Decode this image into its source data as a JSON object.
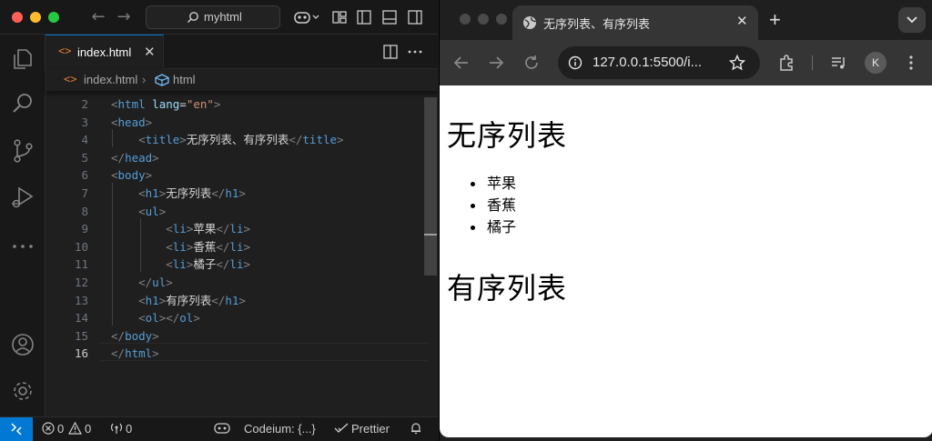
{
  "vscode": {
    "search_text": "myhtml",
    "tab": {
      "label": "index.html",
      "icon": "<>"
    },
    "breadcrumb": {
      "file": "index.html",
      "symbol": "html"
    },
    "lines": [
      {
        "num": "2",
        "tokens": [
          {
            "t": "<",
            "c": "t-bracket"
          },
          {
            "t": "html",
            "c": "t-tag"
          },
          {
            "t": " lang",
            "c": "t-attr"
          },
          {
            "t": "=",
            "c": "t-txt"
          },
          {
            "t": "\"en\"",
            "c": "t-str"
          },
          {
            "t": ">",
            "c": "t-bracket"
          }
        ]
      },
      {
        "num": "3",
        "tokens": [
          {
            "t": "<",
            "c": "t-bracket"
          },
          {
            "t": "head",
            "c": "t-tag"
          },
          {
            "t": ">",
            "c": "t-bracket"
          }
        ]
      },
      {
        "num": "4",
        "tokens": [
          {
            "t": "    ",
            "c": "t-txt"
          },
          {
            "t": "<",
            "c": "t-bracket"
          },
          {
            "t": "title",
            "c": "t-tag"
          },
          {
            "t": ">",
            "c": "t-bracket"
          },
          {
            "t": "无序列表、有序列表",
            "c": "t-txt"
          },
          {
            "t": "</",
            "c": "t-bracket"
          },
          {
            "t": "title",
            "c": "t-tag"
          },
          {
            "t": ">",
            "c": "t-bracket"
          }
        ]
      },
      {
        "num": "5",
        "tokens": [
          {
            "t": "</",
            "c": "t-bracket"
          },
          {
            "t": "head",
            "c": "t-tag"
          },
          {
            "t": ">",
            "c": "t-bracket"
          }
        ]
      },
      {
        "num": "6",
        "tokens": [
          {
            "t": "<",
            "c": "t-bracket"
          },
          {
            "t": "body",
            "c": "t-tag"
          },
          {
            "t": ">",
            "c": "t-bracket"
          }
        ]
      },
      {
        "num": "7",
        "tokens": [
          {
            "t": "    ",
            "c": "t-txt"
          },
          {
            "t": "<",
            "c": "t-bracket"
          },
          {
            "t": "h1",
            "c": "t-tag"
          },
          {
            "t": ">",
            "c": "t-bracket"
          },
          {
            "t": "无序列表",
            "c": "t-txt"
          },
          {
            "t": "</",
            "c": "t-bracket"
          },
          {
            "t": "h1",
            "c": "t-tag"
          },
          {
            "t": ">",
            "c": "t-bracket"
          }
        ]
      },
      {
        "num": "8",
        "tokens": [
          {
            "t": "    ",
            "c": "t-txt"
          },
          {
            "t": "<",
            "c": "t-bracket"
          },
          {
            "t": "ul",
            "c": "t-tag"
          },
          {
            "t": ">",
            "c": "t-bracket"
          }
        ]
      },
      {
        "num": "9",
        "tokens": [
          {
            "t": "        ",
            "c": "t-txt"
          },
          {
            "t": "<",
            "c": "t-bracket"
          },
          {
            "t": "li",
            "c": "t-tag"
          },
          {
            "t": ">",
            "c": "t-bracket"
          },
          {
            "t": "苹果",
            "c": "t-txt"
          },
          {
            "t": "</",
            "c": "t-bracket"
          },
          {
            "t": "li",
            "c": "t-tag"
          },
          {
            "t": ">",
            "c": "t-bracket"
          }
        ]
      },
      {
        "num": "10",
        "tokens": [
          {
            "t": "        ",
            "c": "t-txt"
          },
          {
            "t": "<",
            "c": "t-bracket"
          },
          {
            "t": "li",
            "c": "t-tag"
          },
          {
            "t": ">",
            "c": "t-bracket"
          },
          {
            "t": "香蕉",
            "c": "t-txt"
          },
          {
            "t": "</",
            "c": "t-bracket"
          },
          {
            "t": "li",
            "c": "t-tag"
          },
          {
            "t": ">",
            "c": "t-bracket"
          }
        ]
      },
      {
        "num": "11",
        "tokens": [
          {
            "t": "        ",
            "c": "t-txt"
          },
          {
            "t": "<",
            "c": "t-bracket"
          },
          {
            "t": "li",
            "c": "t-tag"
          },
          {
            "t": ">",
            "c": "t-bracket"
          },
          {
            "t": "橘子",
            "c": "t-txt"
          },
          {
            "t": "</",
            "c": "t-bracket"
          },
          {
            "t": "li",
            "c": "t-tag"
          },
          {
            "t": ">",
            "c": "t-bracket"
          }
        ]
      },
      {
        "num": "12",
        "tokens": [
          {
            "t": "    ",
            "c": "t-txt"
          },
          {
            "t": "</",
            "c": "t-bracket"
          },
          {
            "t": "ul",
            "c": "t-tag"
          },
          {
            "t": ">",
            "c": "t-bracket"
          }
        ]
      },
      {
        "num": "13",
        "tokens": [
          {
            "t": "    ",
            "c": "t-txt"
          },
          {
            "t": "<",
            "c": "t-bracket"
          },
          {
            "t": "h1",
            "c": "t-tag"
          },
          {
            "t": ">",
            "c": "t-bracket"
          },
          {
            "t": "有序列表",
            "c": "t-txt"
          },
          {
            "t": "</",
            "c": "t-bracket"
          },
          {
            "t": "h1",
            "c": "t-tag"
          },
          {
            "t": ">",
            "c": "t-bracket"
          }
        ]
      },
      {
        "num": "14",
        "tokens": [
          {
            "t": "    ",
            "c": "t-txt"
          },
          {
            "t": "<",
            "c": "t-bracket"
          },
          {
            "t": "ol",
            "c": "t-tag"
          },
          {
            "t": "></",
            "c": "t-bracket"
          },
          {
            "t": "ol",
            "c": "t-tag"
          },
          {
            "t": ">",
            "c": "t-bracket"
          }
        ]
      },
      {
        "num": "15",
        "tokens": [
          {
            "t": "</",
            "c": "t-bracket"
          },
          {
            "t": "body",
            "c": "t-tag"
          },
          {
            "t": ">",
            "c": "t-bracket"
          }
        ]
      },
      {
        "num": "16",
        "active": true,
        "tokens": [
          {
            "t": "</",
            "c": "t-bracket"
          },
          {
            "t": "html",
            "c": "t-tag"
          },
          {
            "t": ">",
            "c": "t-bracket"
          }
        ]
      }
    ],
    "status": {
      "errors": "0",
      "warnings": "0",
      "ports": "0",
      "codeium": "Codeium: {...}",
      "prettier": "Prettier"
    },
    "colors": {
      "accent": "#0078d4",
      "editor_bg": "#1f1f1f"
    }
  },
  "chrome": {
    "tab_title": "无序列表、有序列表",
    "url": "127.0.0.1:5500/i...",
    "profile_initial": "K",
    "page": {
      "h1_unordered": "无序列表",
      "list_items": [
        "苹果",
        "香蕉",
        "橘子"
      ],
      "h1_ordered": "有序列表"
    }
  }
}
